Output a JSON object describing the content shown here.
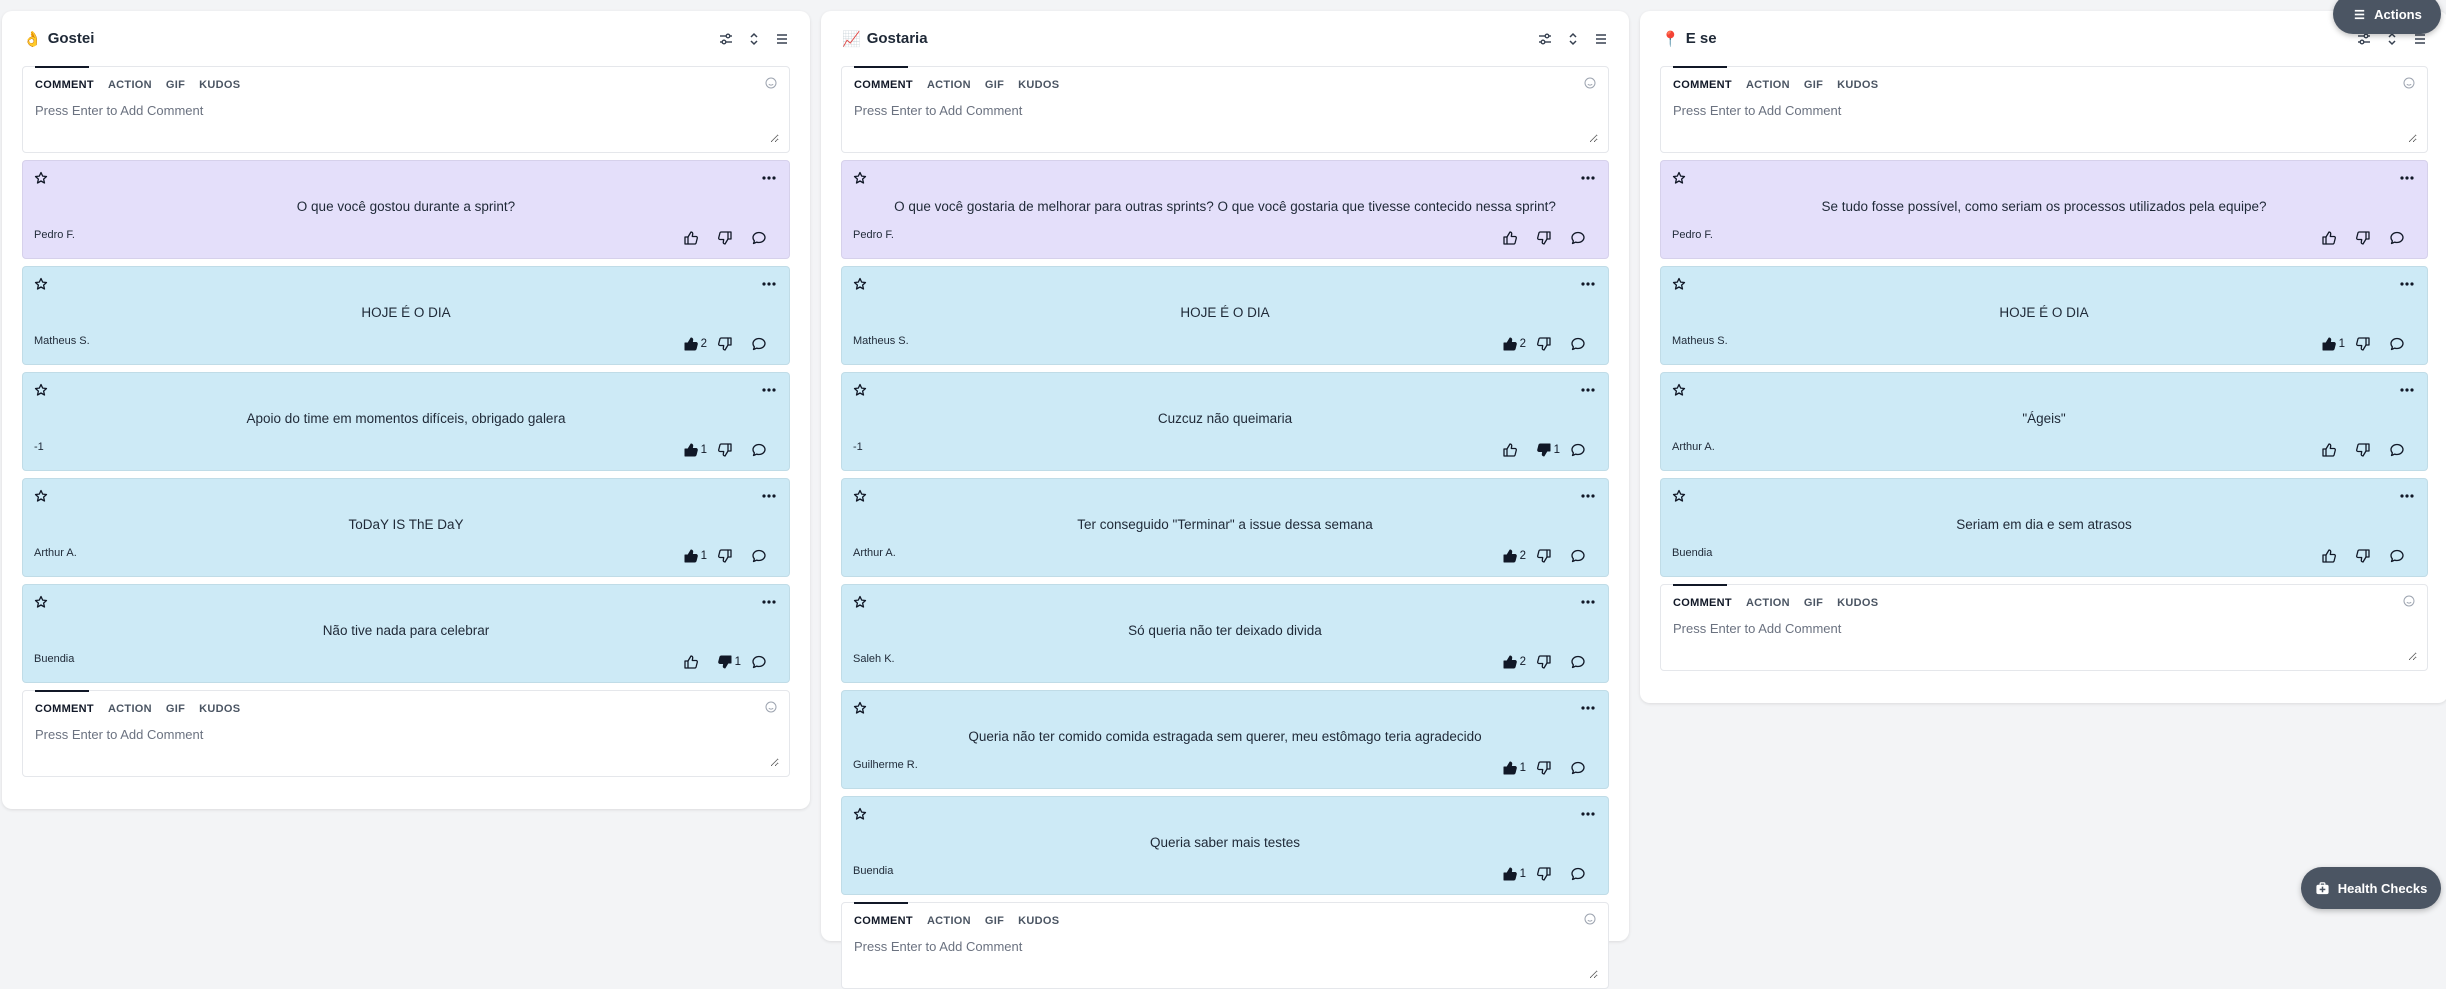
{
  "floating": {
    "actions_label": "Actions",
    "health_checks_label": "Health Checks"
  },
  "composer": {
    "tabs": [
      "COMMENT",
      "ACTION",
      "GIF",
      "KUDOS"
    ],
    "placeholder": "Press Enter to Add Comment"
  },
  "columns": [
    {
      "emoji": "👌",
      "title": "Gostei",
      "cards": [
        {
          "color": "purple",
          "text": "O que você gostou durante a sprint?",
          "author": "Pedro F.",
          "likes": "",
          "dislikes": ""
        },
        {
          "color": "blue",
          "text": "HOJE É O DIA",
          "author": "Matheus S.",
          "likes": "2",
          "dislikes": ""
        },
        {
          "color": "blue",
          "text": "Apoio do time em momentos difíceis, obrigado galera",
          "author": "-1",
          "likes": "1",
          "dislikes": ""
        },
        {
          "color": "blue",
          "text": "ToDaY IS ThE DaY",
          "author": "Arthur A.",
          "likes": "1",
          "dislikes": ""
        },
        {
          "color": "blue",
          "text": "Não tive nada para celebrar",
          "author": "Buendia",
          "likes": "",
          "dislikes": "1"
        }
      ]
    },
    {
      "emoji": "📈",
      "title": "Gostaria",
      "cards": [
        {
          "color": "purple",
          "text": "O que você gostaria de melhorar para outras sprints? O que você gostaria que tivesse contecido nessa sprint?",
          "author": "Pedro F.",
          "likes": "",
          "dislikes": ""
        },
        {
          "color": "blue",
          "text": "HOJE É O DIA",
          "author": "Matheus S.",
          "likes": "2",
          "dislikes": ""
        },
        {
          "color": "blue",
          "text": "Cuzcuz não queimaria",
          "author": "-1",
          "likes": "",
          "dislikes": "1"
        },
        {
          "color": "blue",
          "text": "Ter conseguido \"Terminar\" a issue dessa semana",
          "author": "Arthur A.",
          "likes": "2",
          "dislikes": ""
        },
        {
          "color": "blue",
          "text": "Só queria não ter deixado divida",
          "author": "Saleh K.",
          "likes": "2",
          "dislikes": ""
        },
        {
          "color": "blue",
          "text": "Queria não ter comido comida estragada sem querer, meu estômago teria agradecido",
          "author": "Guilherme R.",
          "likes": "1",
          "dislikes": ""
        },
        {
          "color": "blue",
          "text": "Queria saber mais testes",
          "author": "Buendia",
          "likes": "1",
          "dislikes": ""
        }
      ]
    },
    {
      "emoji": "📍",
      "title": "E se",
      "cards": [
        {
          "color": "purple",
          "text": "Se tudo fosse possível, como seriam os processos utilizados pela equipe?",
          "author": "Pedro F.",
          "likes": "",
          "dislikes": ""
        },
        {
          "color": "blue",
          "text": "HOJE É O DIA",
          "author": "Matheus S.",
          "likes": "1",
          "dislikes": ""
        },
        {
          "color": "blue",
          "text": "\"Ágeis\"",
          "author": "Arthur A.",
          "likes": "",
          "dislikes": ""
        },
        {
          "color": "blue",
          "text": "Seriam em dia e sem atrasos",
          "author": "Buendia",
          "likes": "",
          "dislikes": ""
        }
      ]
    }
  ]
}
